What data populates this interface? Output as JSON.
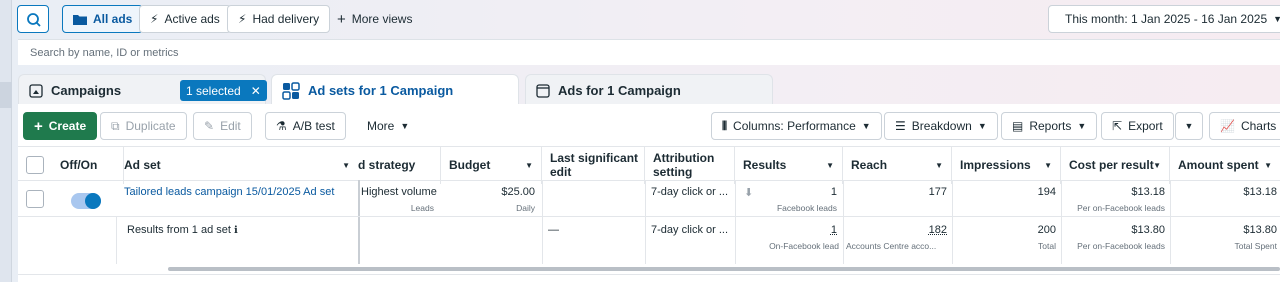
{
  "filters": {
    "all_ads": "All ads",
    "active_ads": "Active ads",
    "had_delivery": "Had delivery",
    "more_views": "More views",
    "date_range": "This month: 1 Jan 2025 - 16 Jan 2025"
  },
  "search": {
    "placeholder": "Search by name, ID or metrics"
  },
  "tabs": {
    "campaigns": "Campaigns",
    "selected_badge": "1 selected",
    "ad_sets": "Ad sets for 1 Campaign",
    "ads": "Ads for 1 Campaign"
  },
  "toolbar": {
    "create": "Create",
    "duplicate": "Duplicate",
    "edit": "Edit",
    "ab_test": "A/B test",
    "more": "More",
    "columns": "Columns: Performance",
    "breakdown": "Breakdown",
    "reports": "Reports",
    "export": "Export",
    "charts": "Charts"
  },
  "table": {
    "headers": {
      "off_on": "Off/On",
      "ad_set": "Ad set",
      "bid_strategy": "d strategy",
      "budget": "Budget",
      "last_edit_1": "Last significant",
      "last_edit_2": "edit",
      "attribution_1": "Attribution",
      "attribution_2": "setting",
      "results": "Results",
      "reach": "Reach",
      "impressions": "Impressions",
      "cost_per_result": "Cost per result",
      "amount_spent": "Amount spent"
    },
    "row": {
      "name": "Tailored leads campaign 15/01/2025 Ad set",
      "bid_strategy": "Highest volume",
      "bid_strategy_sub": "Leads",
      "budget": "$25.00",
      "budget_sub": "Daily",
      "attribution": "7-day click or ...",
      "results": "1",
      "results_sub": "Facebook leads",
      "reach": "177",
      "impressions": "194",
      "cost_per_result": "$13.18",
      "cost_per_result_sub": "Per on-Facebook leads",
      "amount_spent": "$13.18"
    },
    "summary": {
      "label": "Results from 1 ad set",
      "last_edit": "—",
      "attribution": "7-day click or ...",
      "results": "1",
      "results_sub": "On-Facebook lead",
      "reach": "182",
      "reach_sub": "Accounts Centre acco...",
      "impressions": "200",
      "impressions_sub": "Total",
      "cost_per_result": "$13.80",
      "cost_per_result_sub": "Per on-Facebook leads",
      "amount_spent": "$13.80",
      "amount_spent_sub": "Total Spent"
    }
  }
}
